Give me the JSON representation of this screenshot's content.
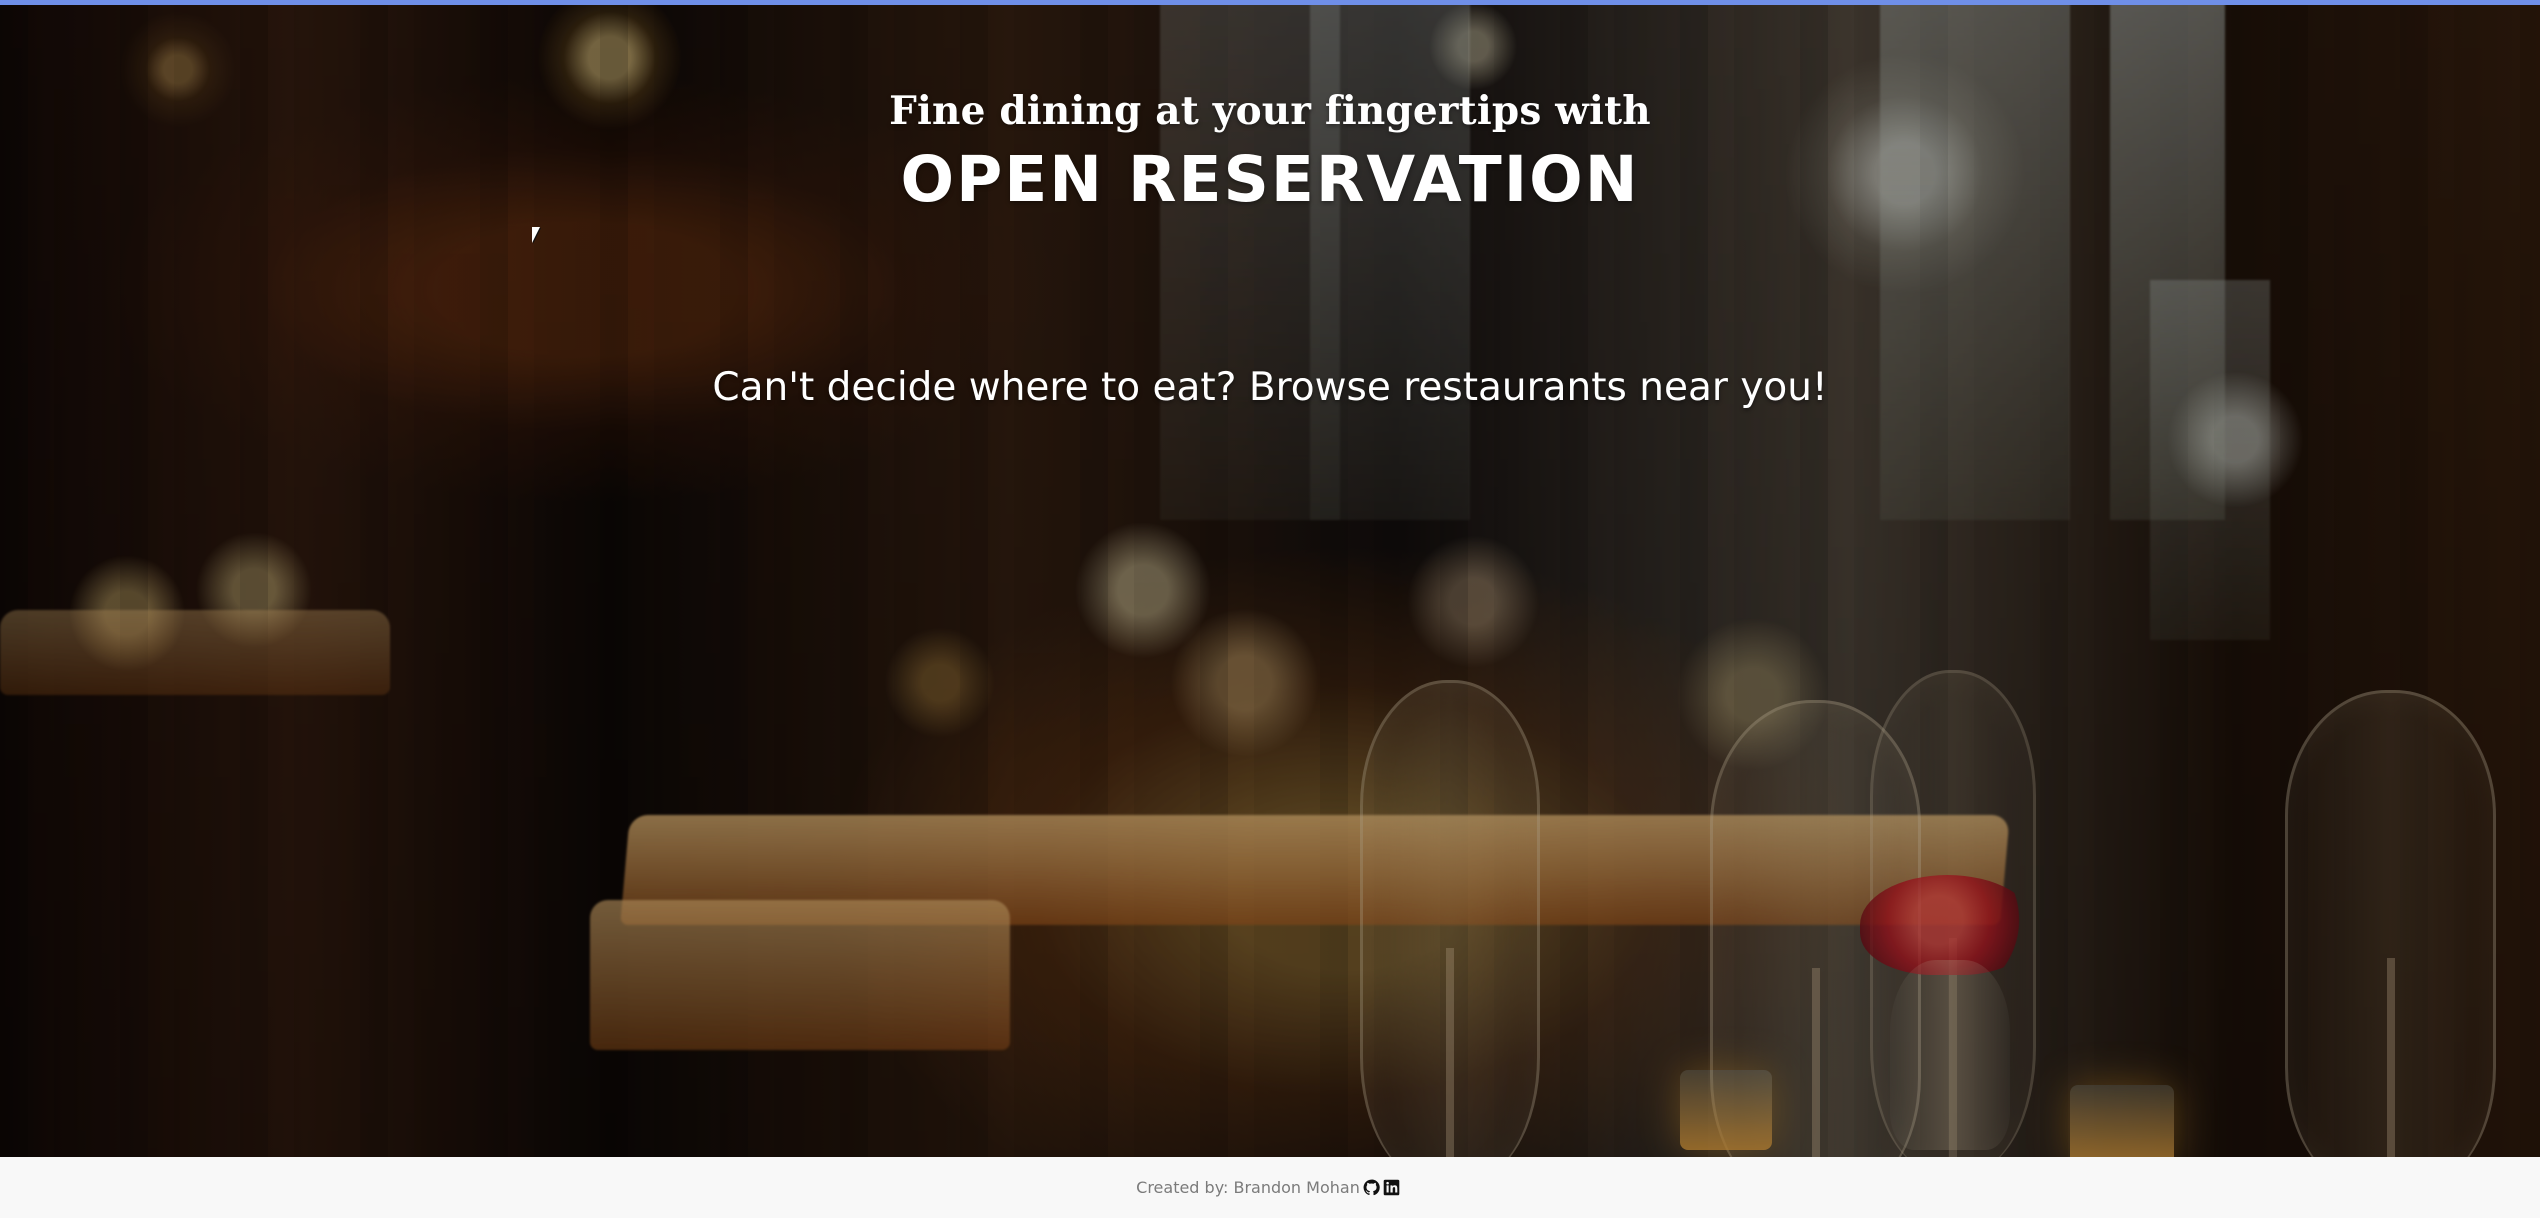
{
  "hero": {
    "tagline": "Fine dining at your fingertips with",
    "title": "OPEN RESERVATION",
    "prompt": "Can't decide where to eat? Browse restaurants near you!"
  },
  "footer": {
    "credit": "Created by: Brandon Mohan",
    "icons": [
      "github-icon",
      "linkedin-icon"
    ]
  },
  "colors": {
    "accent_bar": "#6f8fe8",
    "hero_text": "#ffffff",
    "footer_background": "#f8f8f8",
    "footer_text": "#7b7b7b"
  }
}
